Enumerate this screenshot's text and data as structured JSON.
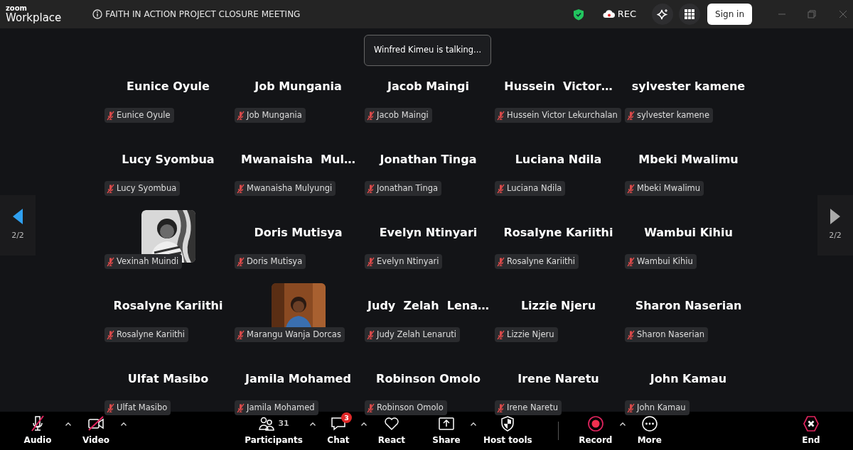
{
  "window": {
    "logo_small": "zoom",
    "logo_large": "Workplace",
    "title": "FAITH IN ACTION PROJECT CLOSURE MEETING",
    "recording_label": "REC",
    "sign_in": "Sign in"
  },
  "talking_banner": "Winfred Kimeu is talking...",
  "pager": {
    "left": "2/2",
    "right": "2/2"
  },
  "tiles": [
    {
      "kind": "name",
      "display": "Eunice Oyule",
      "label": "Eunice Oyule",
      "muted": true
    },
    {
      "kind": "name",
      "display": "Job Mungania",
      "label": "Job Mungania",
      "muted": true
    },
    {
      "kind": "name",
      "display": "Jacob Maingi",
      "label": "Jacob Maingi",
      "muted": true
    },
    {
      "kind": "name",
      "display": "Hussein  Victor…",
      "label": "Hussein Victor Lekurchalan",
      "muted": true
    },
    {
      "kind": "name",
      "display": "sylvester kamene",
      "label": "sylvester kamene",
      "muted": true
    },
    {
      "kind": "name",
      "display": "Lucy Syombua",
      "label": "Lucy Syombua",
      "muted": true
    },
    {
      "kind": "name",
      "display": "Mwanaisha  Mul…",
      "label": "Mwanaisha Mulyungi",
      "muted": true
    },
    {
      "kind": "name",
      "display": "Jonathan Tinga",
      "label": "Jonathan Tinga",
      "muted": true
    },
    {
      "kind": "name",
      "display": "Luciana Ndila",
      "label": "Luciana Ndila",
      "muted": true
    },
    {
      "kind": "name",
      "display": "Mbeki Mwalimu",
      "label": "Mbeki Mwalimu",
      "muted": true
    },
    {
      "kind": "picture",
      "label": "Vexinah Muindi",
      "muted": true
    },
    {
      "kind": "name",
      "display": "Doris Mutisya",
      "label": "Doris Mutisya",
      "muted": true
    },
    {
      "kind": "name",
      "display": "Evelyn Ntinyari",
      "label": "Evelyn Ntinyari",
      "muted": true
    },
    {
      "kind": "name",
      "display": "Rosalyne Kariithi",
      "label": "Rosalyne Kariithi",
      "muted": true
    },
    {
      "kind": "name",
      "display": "Wambui Kihiu",
      "label": "Wambui Kihiu",
      "muted": true
    },
    {
      "kind": "name",
      "display": "Rosalyne Kariithi",
      "label": "Rosalyne Kariithi",
      "muted": true
    },
    {
      "kind": "picture",
      "label": "Marangu Wanja Dorcas",
      "muted": true
    },
    {
      "kind": "name",
      "display": "Judy  Zelah  Lena…",
      "label": "Judy Zelah Lenaruti",
      "muted": true
    },
    {
      "kind": "name",
      "display": "Lizzie Njeru",
      "label": "Lizzie Njeru",
      "muted": true
    },
    {
      "kind": "name",
      "display": "Sharon Naserian",
      "label": "Sharon Naserian",
      "muted": true
    },
    {
      "kind": "name",
      "display": "Ulfat Masibo",
      "label": "Ulfat Masibo",
      "muted": true
    },
    {
      "kind": "name",
      "display": "Jamila Mohamed",
      "label": "Jamila Mohamed",
      "muted": true
    },
    {
      "kind": "name",
      "display": "Robinson Omolo",
      "label": "Robinson Omolo",
      "muted": true
    },
    {
      "kind": "name",
      "display": "Irene Naretu",
      "label": "Irene Naretu",
      "muted": true
    },
    {
      "kind": "name",
      "display": "John Kamau",
      "label": "John Kamau",
      "muted": true
    }
  ],
  "toolbar": [
    {
      "kind": "audio",
      "label": "Audio",
      "caret": true,
      "off": true
    },
    {
      "kind": "video",
      "label": "Video",
      "caret": true,
      "off": true
    },
    {
      "kind": "spacer"
    },
    {
      "kind": "participants",
      "label": "Participants",
      "count": "31",
      "caret": true
    },
    {
      "kind": "chat",
      "label": "Chat",
      "badge": "3",
      "caret": true
    },
    {
      "kind": "react",
      "label": "React",
      "caret": false
    },
    {
      "kind": "share",
      "label": "Share",
      "caret": true
    },
    {
      "kind": "host",
      "label": "Host tools",
      "caret": false
    },
    {
      "kind": "divider"
    },
    {
      "kind": "record",
      "label": "Record",
      "caret": true
    },
    {
      "kind": "more",
      "label": "More",
      "caret": false
    },
    {
      "kind": "spacer"
    },
    {
      "kind": "end",
      "label": "End",
      "caret": false
    }
  ]
}
